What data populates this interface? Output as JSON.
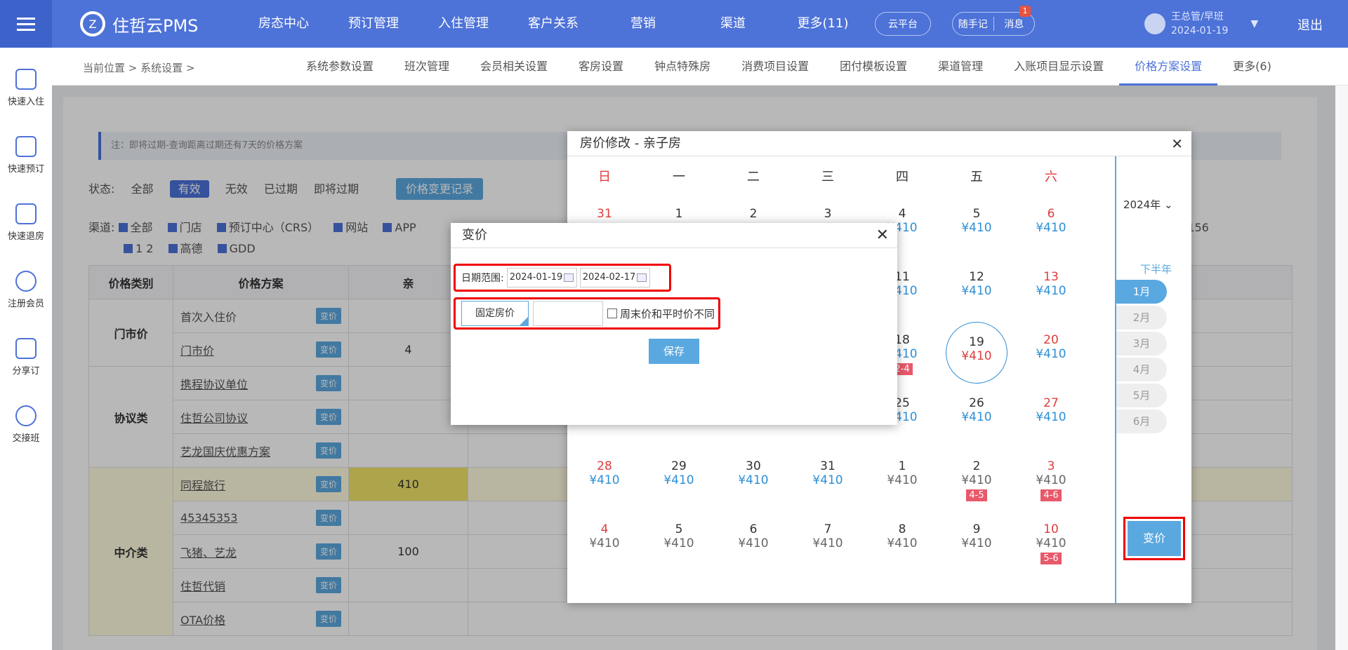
{
  "header": {
    "logo": "住哲云PMS",
    "nav": [
      "房态中心",
      "预订管理",
      "入住管理",
      "客户关系",
      "营销",
      "渠道",
      "更多(11)"
    ],
    "cloud": "云平台",
    "notes": "随手记",
    "msg": "消息",
    "msg_count": "1",
    "user_name": "王总管/早班",
    "user_date": "2024-01-19",
    "logout": "退出"
  },
  "sidebar": [
    "快速入住",
    "快速预订",
    "快速退房",
    "注册会员",
    "分享订",
    "交接班"
  ],
  "subnav": {
    "crumb": "当前位置 > 系统设置 >",
    "tabs": [
      "系统参数设置",
      "班次管理",
      "会员相关设置",
      "客房设置",
      "钟点特殊房",
      "消费项目设置",
      "团付模板设置",
      "渠道管理",
      "入账项目显示设置",
      "价格方案设置",
      "更多(6)"
    ]
  },
  "note": "注：即将过期-查询距离过期还有7天的价格方案",
  "status": {
    "label": "状态:",
    "items": [
      "全部",
      "有效",
      "无效",
      "已过期",
      "即将过期"
    ],
    "log": "价格变更记录"
  },
  "channels": {
    "label": "渠道:",
    "items": [
      "全部",
      "门店",
      "预订中心（CRS）",
      "网站",
      "APP",
      "1 2",
      "高德",
      "GDD"
    ],
    "extra": "123156"
  },
  "table": {
    "headers": [
      "价格类别",
      "价格方案",
      "亲"
    ],
    "groups": [
      "门市价",
      "协议类",
      "中介类"
    ],
    "rows": [
      "首次入住价",
      "门市价",
      "携程协议单位",
      "住哲公司协议",
      "艺龙国庆优惠方案",
      "同程旅行",
      "45345353",
      "飞猪、艺龙",
      "住哲代销",
      "OTA价格"
    ],
    "btn": "变价",
    "vals": {
      "r2": "4",
      "r6": "410",
      "r8": "100"
    }
  },
  "calendar": {
    "title": "房价修改 - 亲子房",
    "weekdays": [
      "日",
      "一",
      "二",
      "三",
      "四",
      "五",
      "六"
    ],
    "weeks": [
      [
        [
          "31",
          ""
        ],
        [
          "1",
          ""
        ],
        [
          "2",
          ""
        ],
        [
          "3",
          ""
        ],
        [
          "4",
          "¥410"
        ],
        [
          "5",
          "¥410"
        ],
        [
          "6",
          "¥410"
        ]
      ],
      [
        [
          "",
          ""
        ],
        [
          "",
          ""
        ],
        [
          "",
          ""
        ],
        [
          "",
          ""
        ],
        [
          "11",
          "¥410"
        ],
        [
          "12",
          "¥410"
        ],
        [
          "13",
          "¥410"
        ]
      ],
      [
        [
          "",
          ""
        ],
        [
          "",
          ""
        ],
        [
          "",
          ""
        ],
        [
          "",
          ""
        ],
        [
          "18",
          "¥410"
        ],
        [
          "19",
          "¥410"
        ],
        [
          "20",
          "¥410"
        ]
      ],
      [
        [
          "",
          ""
        ],
        [
          "",
          ""
        ],
        [
          "",
          ""
        ],
        [
          "",
          ""
        ],
        [
          "25",
          "¥410"
        ],
        [
          "26",
          "¥410"
        ],
        [
          "27",
          "¥410"
        ]
      ],
      [
        [
          "28",
          "¥410"
        ],
        [
          "29",
          "¥410"
        ],
        [
          "30",
          "¥410"
        ],
        [
          "31",
          "¥410"
        ],
        [
          "1",
          "¥410"
        ],
        [
          "2",
          "¥410"
        ],
        [
          "3",
          "¥410"
        ]
      ],
      [
        [
          "4",
          "¥410"
        ],
        [
          "5",
          "¥410"
        ],
        [
          "6",
          "¥410"
        ],
        [
          "7",
          "¥410"
        ],
        [
          "8",
          "¥410"
        ],
        [
          "9",
          "¥410"
        ],
        [
          "10",
          "¥410"
        ]
      ]
    ],
    "holidays": {
      "腊八节": "2-4",
      "北方小年": "4-5",
      "南方小年": "4-6",
      "春节": "5-6"
    },
    "year": "2024年",
    "half": "下半年",
    "months": [
      "1月",
      "2月",
      "3月",
      "4月",
      "5月",
      "6月"
    ],
    "change": "变价"
  },
  "dialog": {
    "title": "变价",
    "range_label": "日期范围:",
    "start": "2024-01-19",
    "end": "2024-02-17",
    "fixed": "固定房价",
    "weekend": "周末价和平时价不同",
    "save": "保存"
  }
}
